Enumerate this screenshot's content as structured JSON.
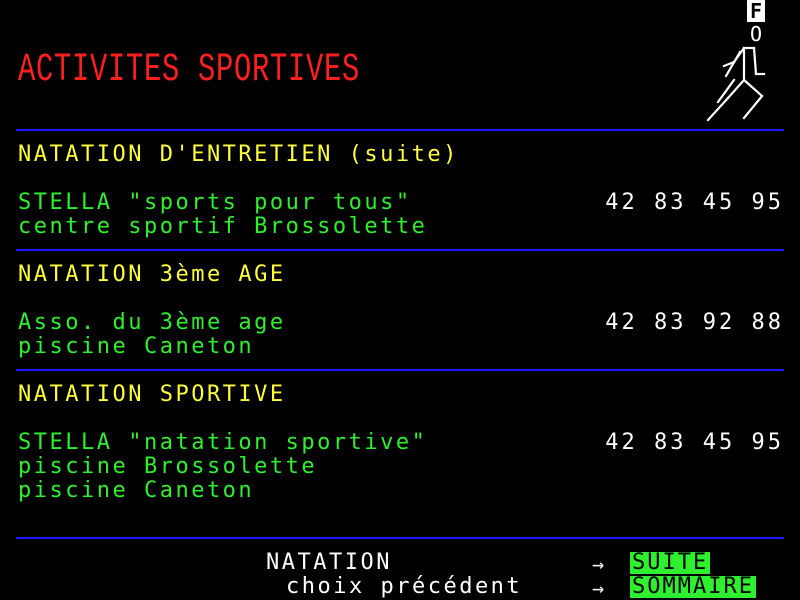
{
  "header": {
    "title": "ACTIVITES SPORTIVES",
    "logo_letter": "F",
    "logo_sub": "O"
  },
  "sections": [
    {
      "heading": "NATATION D'ENTRETIEN (suite)",
      "entries": [
        {
          "lines": [
            "STELLA \"sports pour tous\"",
            "centre sportif Brossolette"
          ],
          "phone": "42 83 45 95"
        }
      ]
    },
    {
      "heading": "NATATION 3ème AGE",
      "entries": [
        {
          "lines": [
            "Asso. du 3ème age",
            "piscine Caneton"
          ],
          "phone": "42 83 92 88"
        }
      ]
    },
    {
      "heading": "NATATION SPORTIVE",
      "entries": [
        {
          "lines": [
            "STELLA \"natation sportive\"",
            "piscine Brossolette",
            "piscine Caneton"
          ],
          "phone": "42 83 45 95"
        }
      ]
    }
  ],
  "footer": {
    "nav1_label": "NATATION",
    "nav1_arrow": "→",
    "nav1_key": "SUITE",
    "nav2_label": "choix précédent",
    "nav2_arrow": "→",
    "nav2_key": "SOMMAIRE"
  },
  "colors": {
    "title": "#ff1f1f",
    "heading": "#ffff3a",
    "entry": "#2ef02e",
    "phone": "#ffffff",
    "rule": "#1a1aff",
    "key_bg": "#2ef02e"
  }
}
